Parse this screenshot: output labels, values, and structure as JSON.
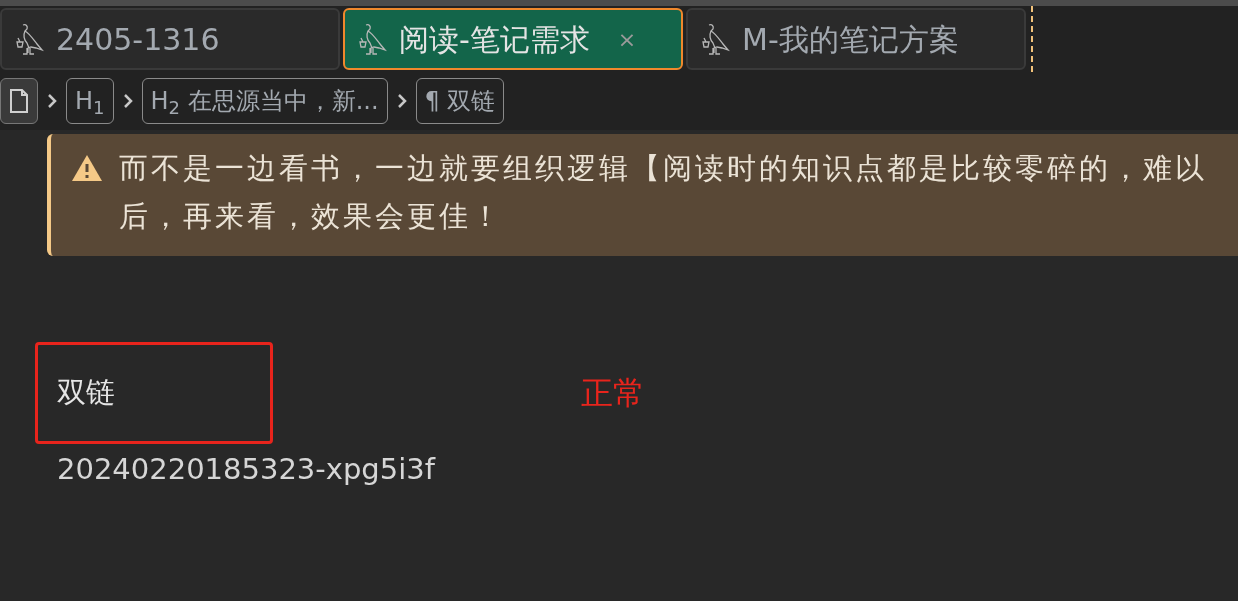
{
  "tabs": [
    {
      "label": "2405-1316",
      "selected": false
    },
    {
      "label": "阅读-笔记需求",
      "selected": true,
      "close": "×"
    },
    {
      "label": "M-我的笔记方案",
      "selected": false
    }
  ],
  "breadcrumb": [
    {
      "kind": "doc"
    },
    {
      "kind": "crumb",
      "text": "H$_{1}$"
    },
    {
      "kind": "crumb",
      "text": "H$_{2}$ 在思源当中，新..."
    },
    {
      "kind": "crumb",
      "text": "¶ 双链"
    }
  ],
  "callout": {
    "kind": "warning",
    "lines": [
      "而不是一边看书，一边就要组织逻辑【阅读时的知识点都是比较零碎的，难以",
      "后，再来看，效果会更佳！"
    ]
  },
  "block": {
    "title": "双链",
    "annotation": "正常",
    "id": "20240220185323-xpg5i3f"
  }
}
